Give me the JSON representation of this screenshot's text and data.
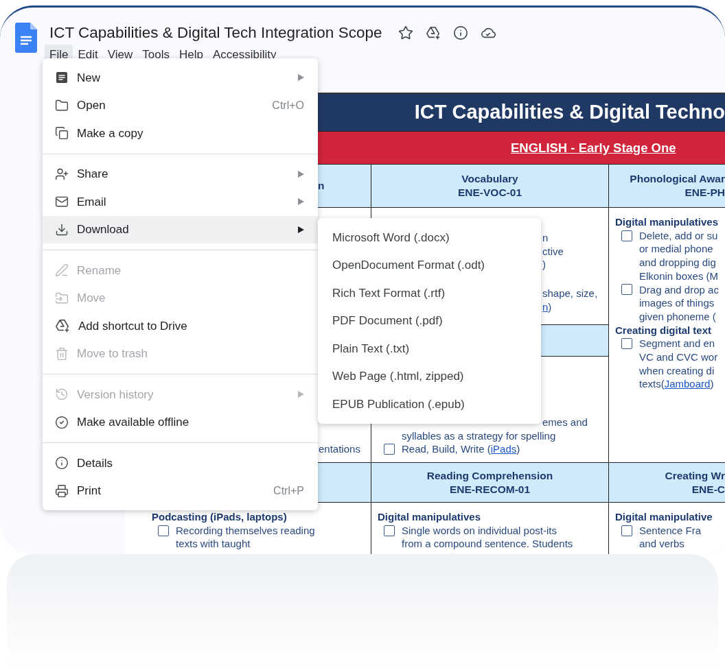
{
  "header": {
    "title": "ICT Capabilities & Digital Tech Integration Scope",
    "menus": [
      {
        "label": "File",
        "selected": true
      },
      {
        "label": "Edit",
        "selected": false
      },
      {
        "label": "View",
        "selected": false
      },
      {
        "label": "Tools",
        "selected": false
      },
      {
        "label": "Help",
        "selected": false
      },
      {
        "label": "Accessibility",
        "selected": false
      }
    ]
  },
  "document": {
    "title": "ICT Capabilities & Digital Techno",
    "subject": "ENGLISH - Early Stage One",
    "rows": [
      {
        "kind": "header",
        "cells": [
          {
            "lines": [
              "n"
            ]
          },
          {
            "lines": [
              "Vocabulary",
              "ENE-VOC-01"
            ]
          },
          {
            "lines": [
              "Phonological Awar",
              "ENE-PH"
            ]
          }
        ]
      },
      {
        "kind": "body",
        "cells": [
          {
            "sections": [
              {
                "kind": "body",
                "lines": [
                  {
                    "kind": "fragment",
                    "text": "entations"
                  }
                ]
              }
            ]
          },
          {
            "sections": [
              {
                "kind": "body",
                "lines": [
                  {
                    "kind": "fragment",
                    "text": "n"
                  },
                  {
                    "kind": "fragment",
                    "text": "ctive"
                  },
                  {
                    "kind": "fragment",
                    "text": ")"
                  },
                  {
                    "kind": "fragment",
                    "text": "shape, size,",
                    "break_before": true
                  },
                  {
                    "kind": "fragment",
                    "link": "n",
                    "after": ")"
                  }
                ]
              },
              {
                "kind": "header"
              },
              {
                "kind": "body",
                "lines": [
                  {
                    "kind": "fragment",
                    "text": "emes and"
                  },
                  {
                    "kind": "text",
                    "text": "syllables as a strategy for spelling"
                  },
                  {
                    "kind": "item",
                    "checked": false,
                    "text": "Read, Build, Write (",
                    "link": "iPads",
                    "after": ")"
                  }
                ]
              }
            ]
          },
          {
            "sections": [
              {
                "kind": "body",
                "lines": [
                  {
                    "kind": "heading",
                    "text": "Digital manipulatives"
                  },
                  {
                    "kind": "item",
                    "checked": false,
                    "text": "Delete, add or su"
                  },
                  {
                    "kind": "text",
                    "text": "or medial phone"
                  },
                  {
                    "kind": "text",
                    "text": "and dropping dig"
                  },
                  {
                    "kind": "text",
                    "text": "Elkonin boxes (M"
                  },
                  {
                    "kind": "item",
                    "checked": false,
                    "text": "Drag and drop ac"
                  },
                  {
                    "kind": "text",
                    "text": "images of things"
                  },
                  {
                    "kind": "text",
                    "text": "given phoneme ("
                  },
                  {
                    "kind": "heading",
                    "text": "Creating digital text"
                  },
                  {
                    "kind": "item",
                    "checked": false,
                    "text": "Segment and en"
                  },
                  {
                    "kind": "text",
                    "text": "VC and CVC wor"
                  },
                  {
                    "kind": "text",
                    "text": "when creating di"
                  },
                  {
                    "kind": "text",
                    "text": "texts(",
                    "link": "Jamboard",
                    "after": ")"
                  }
                ]
              }
            ]
          }
        ]
      },
      {
        "kind": "header",
        "cells": [
          {},
          {
            "lines": [
              "Reading Comprehension",
              "ENE-RECOM-01"
            ]
          },
          {
            "lines": [
              "Creating Wr",
              "ENE-C"
            ]
          }
        ]
      },
      {
        "kind": "body",
        "cells": [
          {
            "sections": [
              {
                "kind": "body",
                "lines": [
                  {
                    "kind": "heading",
                    "text": "Podcasting (iPads, laptops)"
                  },
                  {
                    "kind": "item",
                    "checked": false,
                    "text": "Recording themselves reading"
                  },
                  {
                    "kind": "text",
                    "text": "texts with taught"
                  }
                ]
              }
            ]
          },
          {
            "sections": [
              {
                "kind": "body",
                "lines": [
                  {
                    "kind": "heading",
                    "text": "Digital manipulatives"
                  },
                  {
                    "kind": "item",
                    "checked": false,
                    "text": "Single words on individual post-its"
                  },
                  {
                    "kind": "text",
                    "text": "from a compound sentence. Students"
                  }
                ]
              }
            ]
          },
          {
            "sections": [
              {
                "kind": "body",
                "lines": [
                  {
                    "kind": "heading",
                    "text": "Digital manipulative"
                  },
                  {
                    "kind": "item",
                    "checked": false,
                    "text": "Sentence Fra"
                  },
                  {
                    "kind": "text",
                    "text": "and verbs"
                  }
                ]
              }
            ]
          }
        ]
      }
    ]
  },
  "file_menu": {
    "items": [
      {
        "kind": "item",
        "label": "New",
        "submenu": true,
        "disabled": false,
        "selected": false
      },
      {
        "kind": "item",
        "label": "Open",
        "shortcut": "Ctrl+O",
        "disabled": false,
        "selected": false
      },
      {
        "kind": "item",
        "label": "Make a copy",
        "disabled": false,
        "selected": false
      },
      {
        "kind": "separator"
      },
      {
        "kind": "item",
        "label": "Share",
        "submenu": true,
        "disabled": false,
        "selected": false
      },
      {
        "kind": "item",
        "label": "Email",
        "submenu": true,
        "disabled": false,
        "selected": false
      },
      {
        "kind": "item",
        "label": "Download",
        "submenu": true,
        "disabled": false,
        "selected": true
      },
      {
        "kind": "separator"
      },
      {
        "kind": "item",
        "label": "Rename",
        "disabled": true,
        "selected": false
      },
      {
        "kind": "item",
        "label": "Move",
        "disabled": true,
        "selected": false
      },
      {
        "kind": "item",
        "label": "Add shortcut to Drive",
        "disabled": false,
        "selected": false
      },
      {
        "kind": "item",
        "label": "Move to trash",
        "disabled": true,
        "selected": false
      },
      {
        "kind": "separator"
      },
      {
        "kind": "item",
        "label": "Version history",
        "submenu": true,
        "disabled": true,
        "selected": false
      },
      {
        "kind": "item",
        "label": "Make available offline",
        "disabled": false,
        "selected": false
      },
      {
        "kind": "separator"
      },
      {
        "kind": "item",
        "label": "Details",
        "disabled": false,
        "selected": false
      },
      {
        "kind": "item",
        "label": "Print",
        "shortcut": "Ctrl+P",
        "disabled": false,
        "selected": false
      }
    ]
  },
  "download_menu": {
    "items": [
      "Microsoft Word (.docx)",
      "OpenDocument Format (.odt)",
      "Rich Text Format (.rtf)",
      "PDF Document (.pdf)",
      "Plain Text (.txt)",
      "Web Page (.html, zipped)",
      "EPUB Publication (.epub)"
    ]
  }
}
